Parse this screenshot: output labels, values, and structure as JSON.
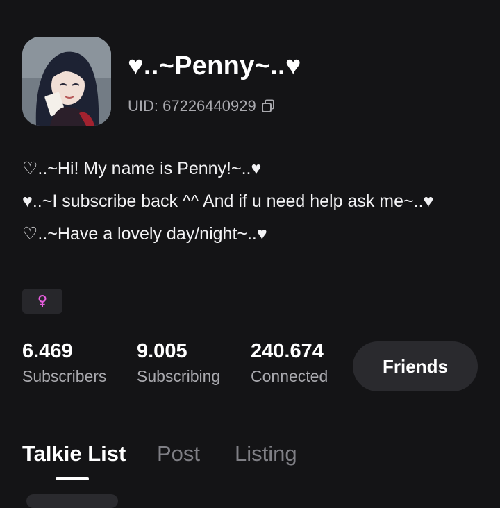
{
  "profile": {
    "name": "♥..~Penny~..♥",
    "uid_text": "UID: 67226440929",
    "copy_icon": "copy-icon",
    "avatar_icon": "anime-avatar",
    "bio_lines": [
      "♡..~Hi! My name is Penny!~..♥",
      "♥..~I subscribe back ^^ And if u need help ask me~..♥",
      "♡..~Have a lovely day/night~..♥"
    ],
    "gender_icon": "female-symbol-icon",
    "gender_color": "#e85fe0"
  },
  "stats": [
    {
      "value": "6.469",
      "label": "Subscribers"
    },
    {
      "value": "9.005",
      "label": "Subscribing"
    },
    {
      "value": "240.674",
      "label": "Connected"
    }
  ],
  "actions": {
    "friends_label": "Friends"
  },
  "tabs": [
    {
      "label": "Talkie List",
      "active": true
    },
    {
      "label": "Post",
      "active": false
    },
    {
      "label": "Listing",
      "active": false
    }
  ],
  "colors": {
    "background": "#141416",
    "muted_text": "#a9a9ae",
    "button_bg": "#2a2a2e"
  }
}
